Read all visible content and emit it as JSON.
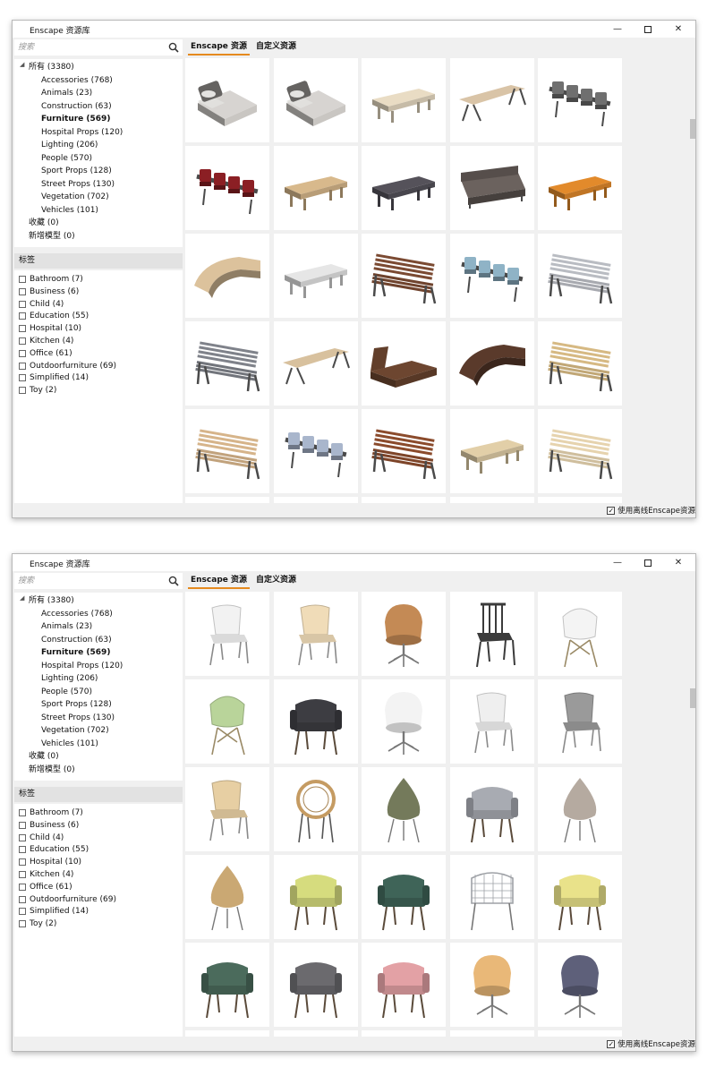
{
  "windows": [
    {
      "title": "Enscape 资源库",
      "search": {
        "placeholder": "搜索"
      },
      "tree": [
        {
          "label": "所有 (3380)",
          "level": 0,
          "expanded": true
        },
        {
          "label": "Accessories (768)",
          "level": 1
        },
        {
          "label": "Animals (23)",
          "level": 1
        },
        {
          "label": "Construction (63)",
          "level": 1
        },
        {
          "label": "Furniture (569)",
          "level": 1,
          "selected": true
        },
        {
          "label": "Hospital Props (120)",
          "level": 1
        },
        {
          "label": "Lighting (206)",
          "level": 1
        },
        {
          "label": "People (570)",
          "level": 1
        },
        {
          "label": "Sport Props (128)",
          "level": 1
        },
        {
          "label": "Street Props (130)",
          "level": 1
        },
        {
          "label": "Vegetation (702)",
          "level": 1
        },
        {
          "label": "Vehicles (101)",
          "level": 1
        },
        {
          "label": "收藏 (0)",
          "level": 0
        },
        {
          "label": "新增模型 (0)",
          "level": 0
        }
      ],
      "tags_header": "标签",
      "tags": [
        "Bathroom (7)",
        "Business (6)",
        "Child (4)",
        "Education (55)",
        "Hospital (10)",
        "Kitchen (4)",
        "Office (61)",
        "Outdoorfurniture (69)",
        "Simplified (14)",
        "Toy (2)"
      ],
      "tabs": [
        {
          "label": "Enscape 资源",
          "active": true
        },
        {
          "label": "自定义资源",
          "active": false
        }
      ],
      "offline_label": "使用离线Enscape资源",
      "scroll_thumb_fraction": 0.18,
      "grid_items": [
        {
          "icon": "bed-icon",
          "color": "#c9c6c2"
        },
        {
          "icon": "bed-icon",
          "color": "#c9c6c2"
        },
        {
          "icon": "bench-icon",
          "color": "#e9dcc4"
        },
        {
          "icon": "table-bench-icon",
          "color": "#d9c4a7"
        },
        {
          "icon": "seating-row-icon",
          "color": "#6f6f6f"
        },
        {
          "icon": "seating-row-icon",
          "color": "#8b1f24"
        },
        {
          "icon": "bench-icon",
          "color": "#d8b98c"
        },
        {
          "icon": "bench-icon",
          "color": "#55525a"
        },
        {
          "icon": "sofa-icon",
          "color": "#6b625e"
        },
        {
          "icon": "bench-icon",
          "color": "#e28a2b"
        },
        {
          "icon": "curved-bench-icon",
          "color": "#dcc29c"
        },
        {
          "icon": "bench-icon",
          "color": "#e6e6e6"
        },
        {
          "icon": "park-bench-icon",
          "color": "#7b4a32"
        },
        {
          "icon": "seating-row-icon",
          "color": "#8fb3c6"
        },
        {
          "icon": "park-bench-icon",
          "color": "#b9bcc2"
        },
        {
          "icon": "park-bench-icon",
          "color": "#7f828a"
        },
        {
          "icon": "table-bench-icon",
          "color": "#d8c19e"
        },
        {
          "icon": "lounger-icon",
          "color": "#6d4630"
        },
        {
          "icon": "curved-bench-icon",
          "color": "#5a3a2b"
        },
        {
          "icon": "park-bench-icon",
          "color": "#d6b983"
        },
        {
          "icon": "park-bench-icon",
          "color": "#d6b48a"
        },
        {
          "icon": "seating-row-icon",
          "color": "#a9b6cc"
        },
        {
          "icon": "park-bench-icon",
          "color": "#8b4b2c"
        },
        {
          "icon": "bench-icon",
          "color": "#e2cfa8"
        },
        {
          "icon": "park-bench-icon",
          "color": "#e6d3ae"
        }
      ]
    },
    {
      "title": "Enscape 资源库",
      "search": {
        "placeholder": "搜索"
      },
      "tree": [
        {
          "label": "所有 (3380)",
          "level": 0,
          "expanded": true
        },
        {
          "label": "Accessories (768)",
          "level": 1
        },
        {
          "label": "Animals (23)",
          "level": 1
        },
        {
          "label": "Construction (63)",
          "level": 1
        },
        {
          "label": "Furniture (569)",
          "level": 1,
          "selected": true
        },
        {
          "label": "Hospital Props (120)",
          "level": 1
        },
        {
          "label": "Lighting (206)",
          "level": 1
        },
        {
          "label": "People (570)",
          "level": 1
        },
        {
          "label": "Sport Props (128)",
          "level": 1
        },
        {
          "label": "Street Props (130)",
          "level": 1
        },
        {
          "label": "Vegetation (702)",
          "level": 1
        },
        {
          "label": "Vehicles (101)",
          "level": 1
        },
        {
          "label": "收藏 (0)",
          "level": 0
        },
        {
          "label": "新增模型 (0)",
          "level": 0
        }
      ],
      "tags_header": "标签",
      "tags": [
        "Bathroom (7)",
        "Business (6)",
        "Child (4)",
        "Education (55)",
        "Hospital (10)",
        "Kitchen (4)",
        "Office (61)",
        "Outdoorfurniture (69)",
        "Simplified (14)",
        "Toy (2)"
      ],
      "tabs": [
        {
          "label": "Enscape 资源",
          "active": true
        },
        {
          "label": "自定义资源",
          "active": false
        }
      ],
      "offline_label": "使用离线Enscape资源",
      "scroll_thumb_fraction": 0.26,
      "grid_items": [
        {
          "icon": "chair-icon",
          "color": "#f2f2f2"
        },
        {
          "icon": "chair-icon",
          "color": "#f0dcb8"
        },
        {
          "icon": "swivel-chair-icon",
          "color": "#c48a55"
        },
        {
          "icon": "spindle-chair-icon",
          "color": "#3b3b3b"
        },
        {
          "icon": "eames-chair-icon",
          "color": "#f4f4f4"
        },
        {
          "icon": "eames-chair-icon",
          "color": "#b9d49a"
        },
        {
          "icon": "armchair-icon",
          "color": "#3d3d42"
        },
        {
          "icon": "swivel-chair-icon",
          "color": "#f3f3f3"
        },
        {
          "icon": "chair-icon",
          "color": "#efefef"
        },
        {
          "icon": "chair-icon",
          "color": "#9a9a9a"
        },
        {
          "icon": "chair-icon",
          "color": "#e7cfa3"
        },
        {
          "icon": "rattan-chair-icon",
          "color": "#c59b62"
        },
        {
          "icon": "egg-chair-icon",
          "color": "#747a5b"
        },
        {
          "icon": "armchair-icon",
          "color": "#a8abb2"
        },
        {
          "icon": "egg-chair-icon",
          "color": "#b5aaa0"
        },
        {
          "icon": "egg-chair-icon",
          "color": "#caa873"
        },
        {
          "icon": "armchair-icon",
          "color": "#d6dc7e"
        },
        {
          "icon": "armchair-icon",
          "color": "#3f6458"
        },
        {
          "icon": "wire-chair-icon",
          "color": "#9ea1a6"
        },
        {
          "icon": "armchair-icon",
          "color": "#e9e28a"
        },
        {
          "icon": "armchair-icon",
          "color": "#4b6b5c"
        },
        {
          "icon": "armchair-icon",
          "color": "#6b6a6e"
        },
        {
          "icon": "armchair-icon",
          "color": "#e3a1a5"
        },
        {
          "icon": "swivel-chair-icon",
          "color": "#e9b878"
        },
        {
          "icon": "swivel-chair-icon",
          "color": "#5e607a"
        }
      ]
    }
  ]
}
